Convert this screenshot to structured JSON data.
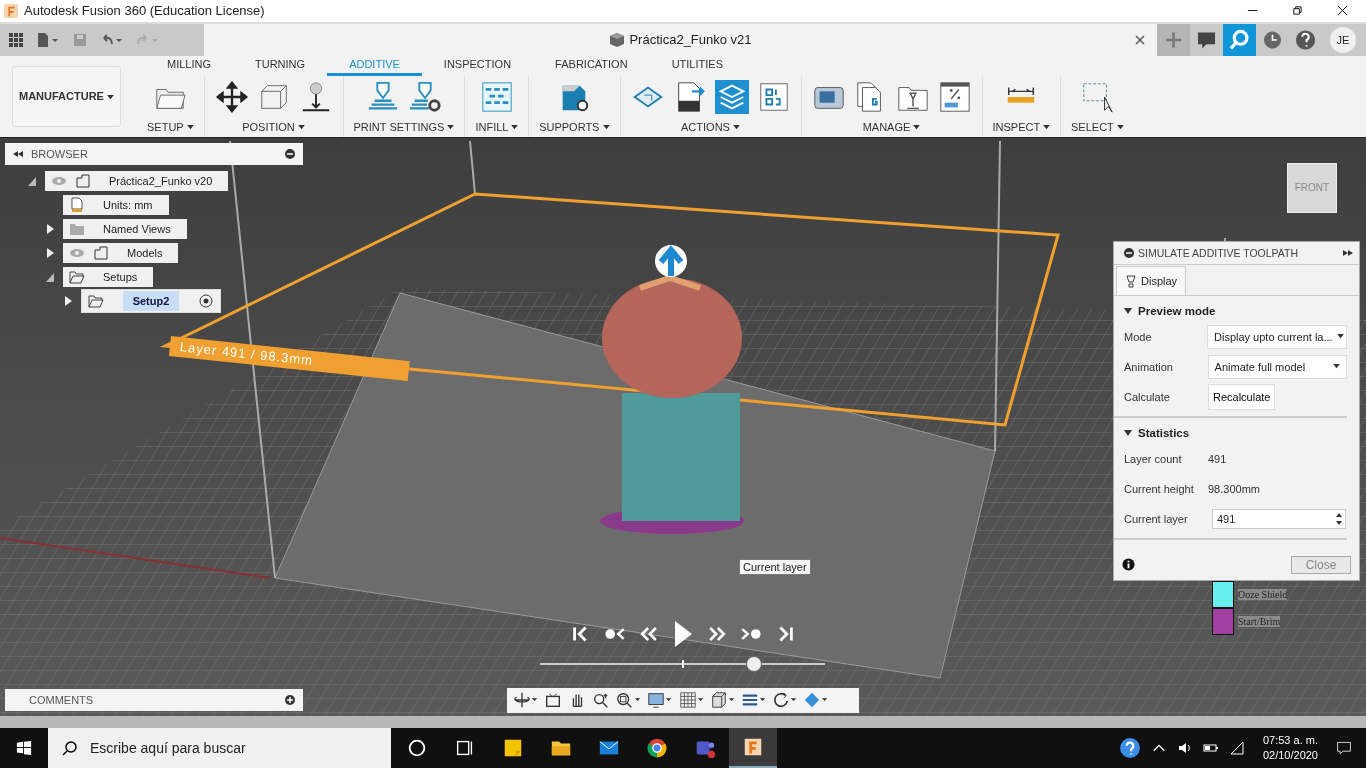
{
  "window": {
    "title": "Autodesk Fusion 360 (Education License)"
  },
  "doc_tab": {
    "title": "Práctica2_Funko v21",
    "avatar": "JE"
  },
  "workspace": "MANUFACTURE",
  "ribbon_tabs": [
    {
      "label": "MILLING",
      "selected": false
    },
    {
      "label": "TURNING",
      "selected": false
    },
    {
      "label": "ADDITIVE",
      "selected": true
    },
    {
      "label": "INSPECTION",
      "selected": false
    },
    {
      "label": "FABRICATION",
      "selected": false
    },
    {
      "label": "UTILITIES",
      "selected": false
    }
  ],
  "ribbon_groups": [
    {
      "label": "SETUP",
      "tools": [
        {
          "kind": "folder"
        }
      ]
    },
    {
      "label": "POSITION",
      "tools": [
        {
          "kind": "move"
        },
        {
          "kind": "bbox"
        },
        {
          "kind": "drop"
        }
      ]
    },
    {
      "label": "PRINT SETTINGS",
      "tools": [
        {
          "kind": "nozzle"
        },
        {
          "kind": "nozzle-gear"
        }
      ]
    },
    {
      "label": "INFILL",
      "tools": [
        {
          "kind": "hex"
        }
      ]
    },
    {
      "label": "SUPPORTS",
      "tools": [
        {
          "kind": "support"
        }
      ]
    },
    {
      "label": "ACTIONS",
      "tools": [
        {
          "kind": "plate"
        },
        {
          "kind": "file3mf"
        },
        {
          "kind": "simulate"
        },
        {
          "kind": "gcode"
        }
      ]
    },
    {
      "label": "MANAGE",
      "tools": [
        {
          "kind": "machine"
        },
        {
          "kind": "docs"
        },
        {
          "kind": "folder-print"
        },
        {
          "kind": "percent"
        }
      ]
    },
    {
      "label": "INSPECT",
      "tools": [
        {
          "kind": "ruler"
        }
      ]
    },
    {
      "label": "SELECT",
      "tools": [
        {
          "kind": "select"
        }
      ]
    }
  ],
  "browser": {
    "title": "BROWSER",
    "tree": [
      {
        "label": "Práctica2_Funko v20",
        "kind": "component",
        "expanded": true,
        "selected": false,
        "children": [
          {
            "label": "Units: mm",
            "kind": "units",
            "selected": false
          },
          {
            "label": "Named Views",
            "kind": "folder",
            "expanded": false,
            "selected": false
          },
          {
            "label": "Models",
            "kind": "component",
            "expanded": false,
            "selected": false
          },
          {
            "label": "Setups",
            "kind": "setups",
            "expanded": true,
            "selected": false,
            "children": [
              {
                "label": "Setup2",
                "kind": "setup",
                "expanded": false,
                "selected": true
              }
            ]
          }
        ]
      }
    ]
  },
  "comments": {
    "title": "COMMENTS"
  },
  "viewport": {
    "layer_label": "Layer 491 / 98.3mm",
    "tooltip": "Current layer",
    "view_cube": "FRONT",
    "legend": [
      {
        "label": "Ooze Shield",
        "color": "#66f0f0"
      },
      {
        "label": "Start/Brim",
        "color": "#a040a0"
      }
    ],
    "timeline": {
      "level": 0.75
    }
  },
  "panel": {
    "title": "SIMULATE ADDITIVE TOOLPATH",
    "tab": "Display",
    "preview": {
      "title": "Preview mode",
      "fields": [
        {
          "label": "Mode",
          "kind": "select",
          "value": "Display upto current la..."
        },
        {
          "label": "Animation",
          "kind": "select",
          "value": "Animate full model"
        },
        {
          "label": "Calculate",
          "kind": "button",
          "value": "Recalculate"
        }
      ]
    },
    "statistics": {
      "title": "Statistics",
      "fields": [
        {
          "label": "Layer count",
          "kind": "text",
          "value": "491"
        },
        {
          "label": "Current height",
          "kind": "text",
          "value": "98.300mm"
        },
        {
          "label": "Current layer",
          "kind": "spinner",
          "value": "491"
        }
      ]
    },
    "close": "Close"
  },
  "taskbar": {
    "search_placeholder": "Escribe aquí para buscar",
    "time": "07:53 a. m.",
    "date": "02/10/2020",
    "apps": [
      {
        "kind": "cortana",
        "selected": false
      },
      {
        "kind": "taskview",
        "selected": false
      },
      {
        "kind": "notes",
        "selected": false
      },
      {
        "kind": "explorer",
        "selected": false
      },
      {
        "kind": "mail",
        "selected": false
      },
      {
        "kind": "chrome",
        "selected": false
      },
      {
        "kind": "teams",
        "selected": false
      },
      {
        "kind": "fusion",
        "selected": true
      }
    ]
  }
}
